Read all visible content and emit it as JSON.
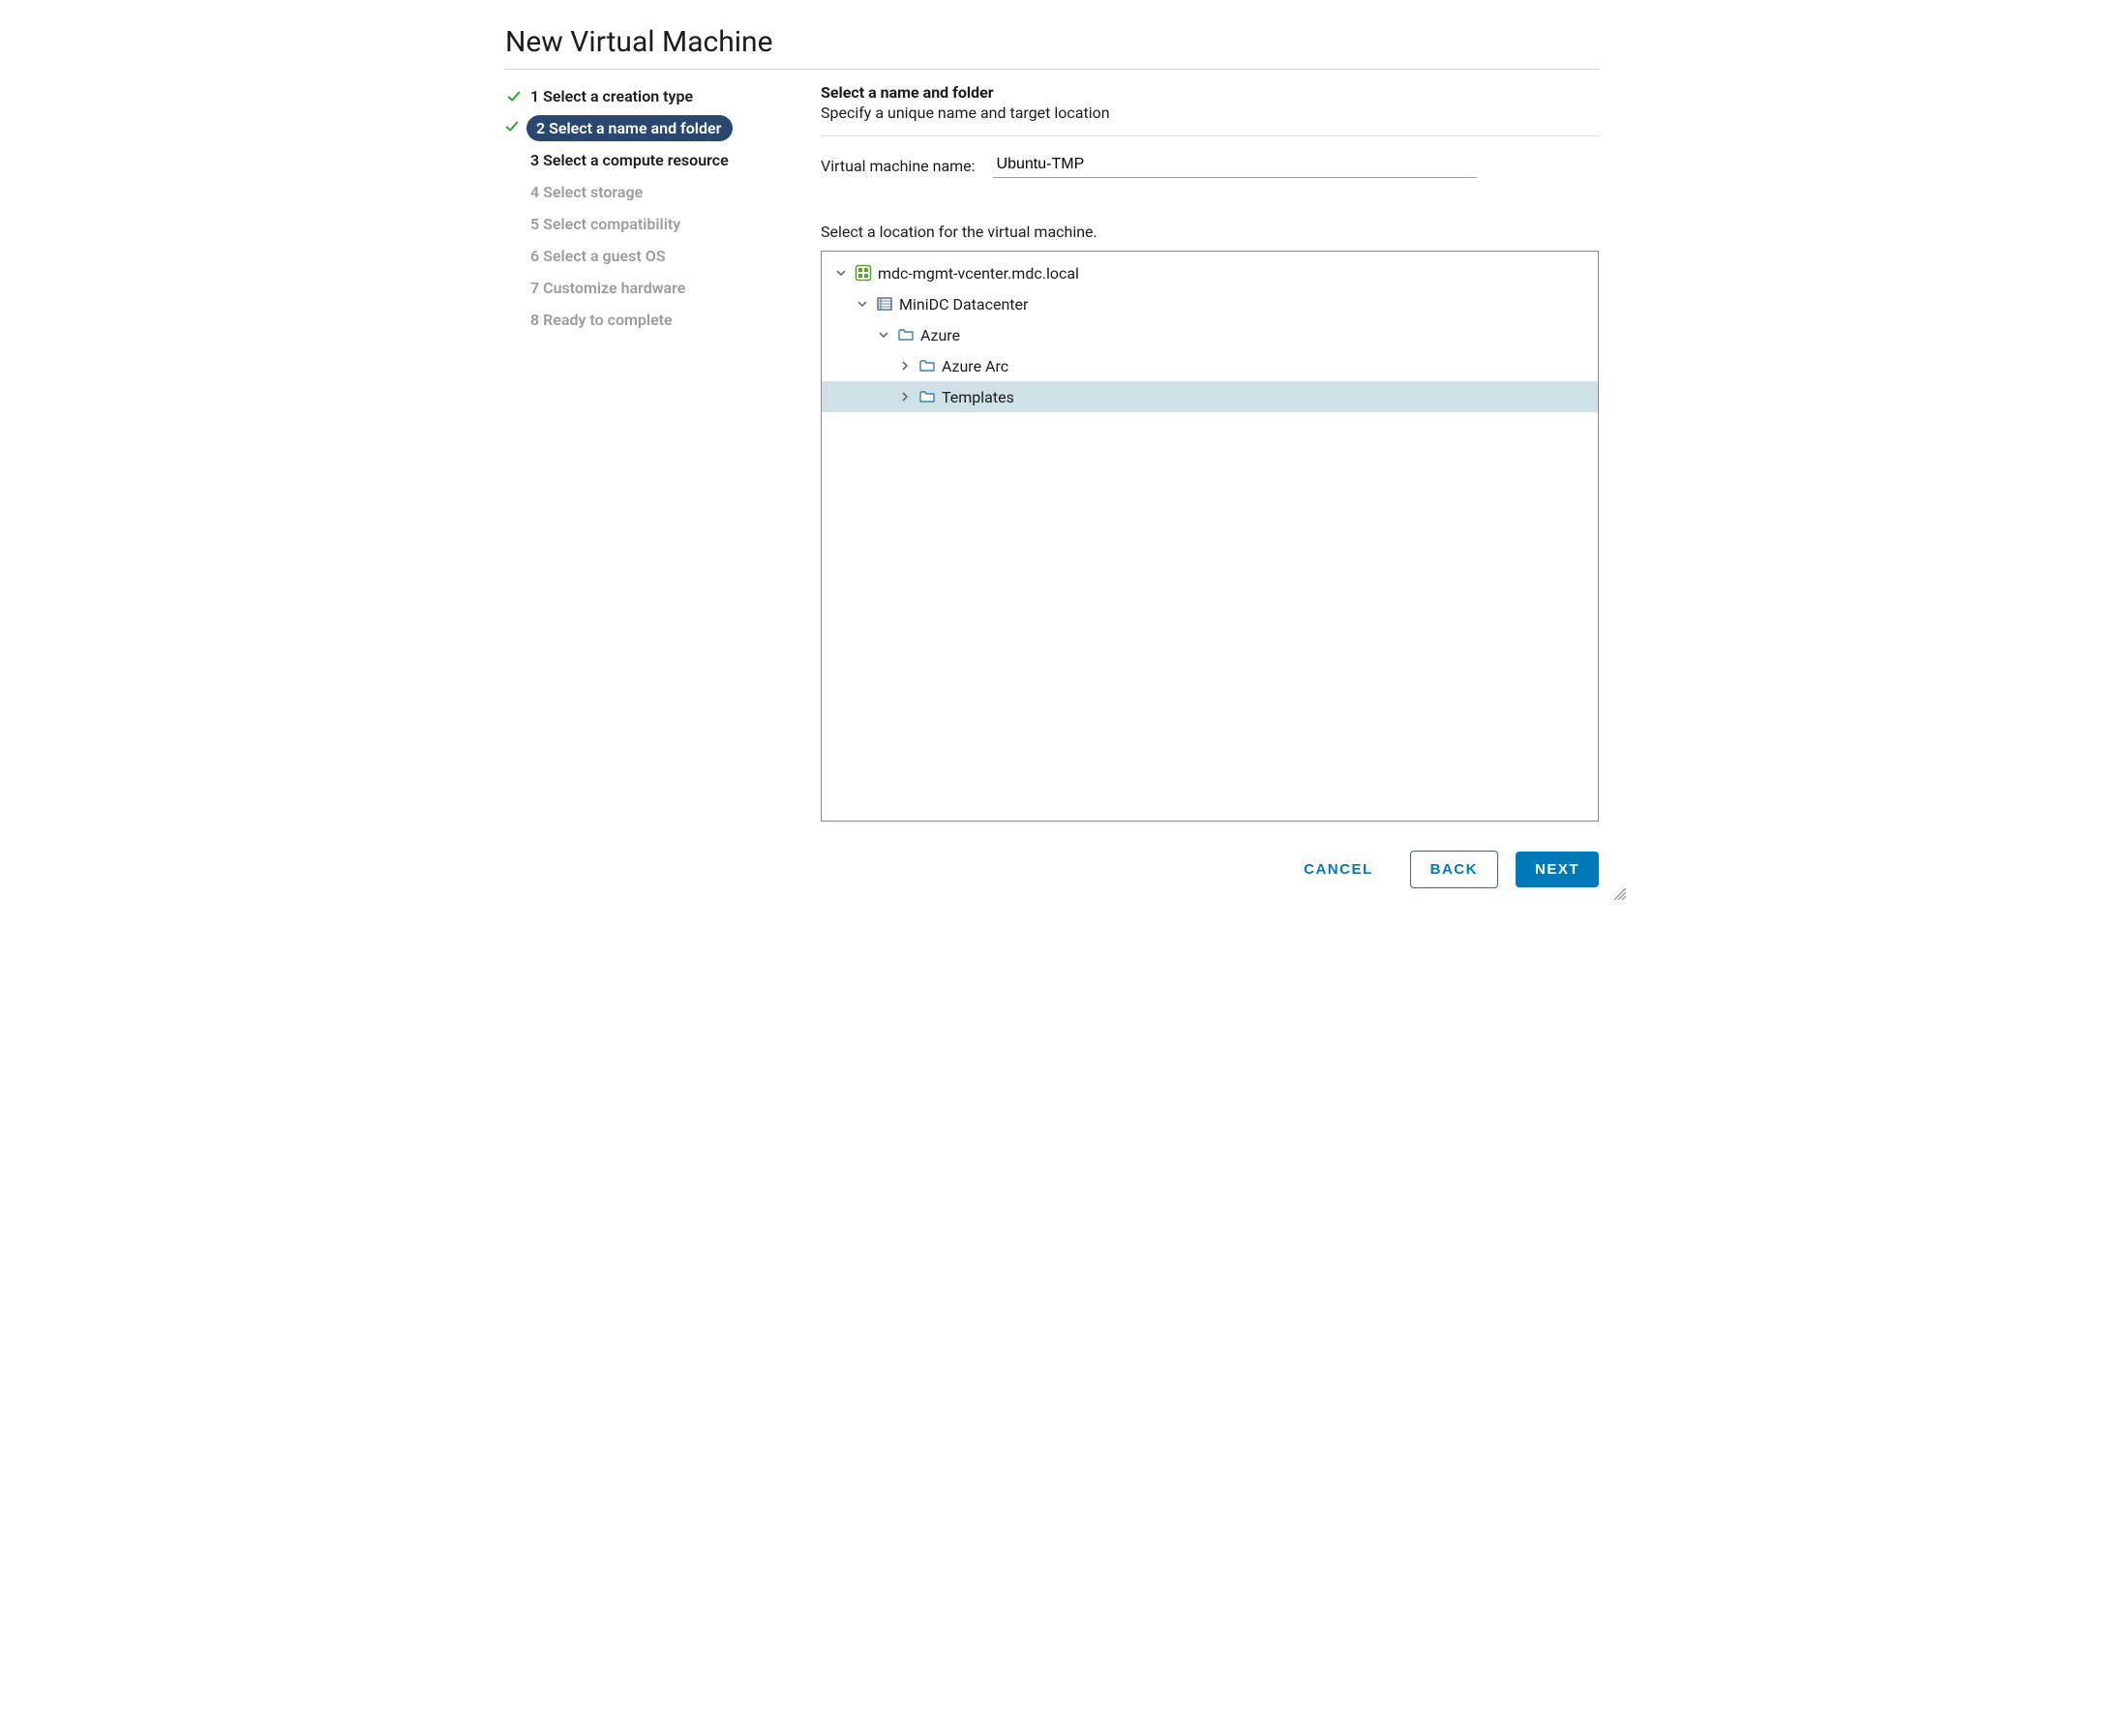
{
  "dialog": {
    "title": "New Virtual Machine"
  },
  "steps": [
    {
      "num": "1",
      "label": "Select a creation type",
      "state": "completed"
    },
    {
      "num": "2",
      "label": "Select a name and folder",
      "state": "active"
    },
    {
      "num": "3",
      "label": "Select a compute resource",
      "state": "near"
    },
    {
      "num": "4",
      "label": "Select storage",
      "state": "future"
    },
    {
      "num": "5",
      "label": "Select compatibility",
      "state": "future"
    },
    {
      "num": "6",
      "label": "Select a guest OS",
      "state": "future"
    },
    {
      "num": "7",
      "label": "Customize hardware",
      "state": "future"
    },
    {
      "num": "8",
      "label": "Ready to complete",
      "state": "future"
    }
  ],
  "panel": {
    "title": "Select a name and folder",
    "subtitle": "Specify a unique name and target location",
    "vm_name_label": "Virtual machine name:",
    "vm_name_value": "Ubuntu-TMP",
    "location_caption": "Select a location for the virtual machine."
  },
  "tree": [
    {
      "id": "root",
      "indent": 0,
      "expand": "open",
      "icon": "vcenter",
      "label": "mdc-mgmt-vcenter.mdc.local",
      "selected": false
    },
    {
      "id": "dc",
      "indent": 1,
      "expand": "open",
      "icon": "datacenter",
      "label": "MiniDC Datacenter",
      "selected": false
    },
    {
      "id": "az",
      "indent": 2,
      "expand": "open",
      "icon": "folder",
      "label": "Azure",
      "selected": false
    },
    {
      "id": "arc",
      "indent": 3,
      "expand": "closed",
      "icon": "folder",
      "label": "Azure Arc",
      "selected": false
    },
    {
      "id": "tmpl",
      "indent": 3,
      "expand": "closed",
      "icon": "folder",
      "label": "Templates",
      "selected": true
    }
  ],
  "footer": {
    "cancel": "CANCEL",
    "back": "BACK",
    "next": "NEXT"
  }
}
